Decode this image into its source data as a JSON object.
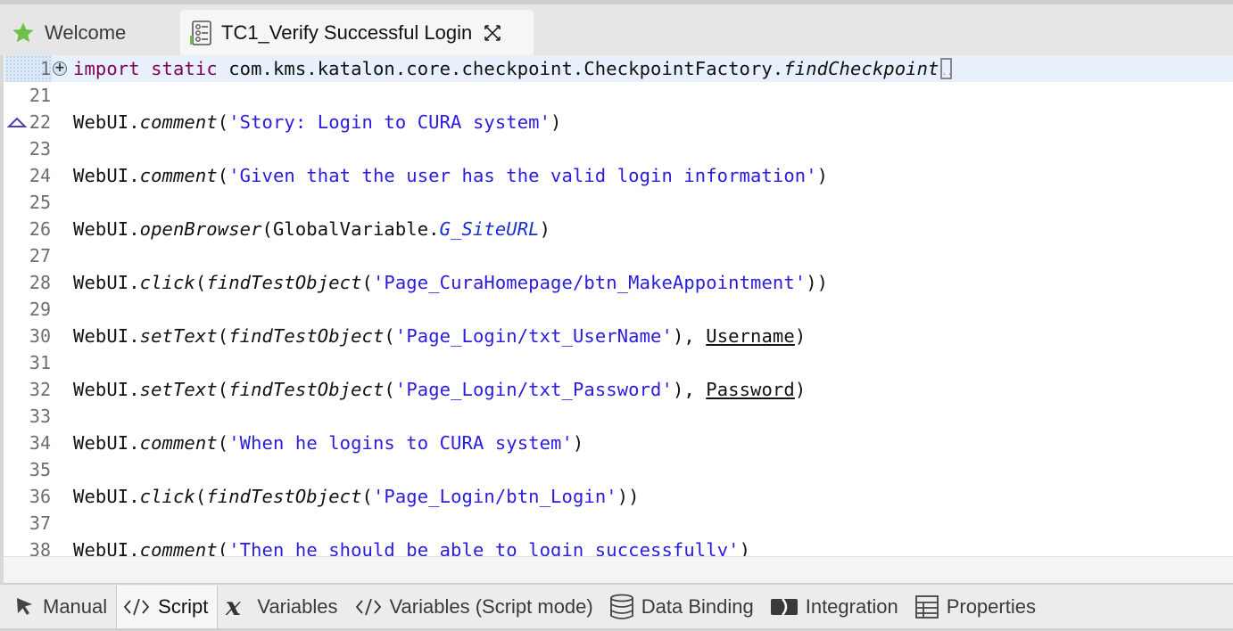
{
  "tabs": [
    {
      "label": "Welcome",
      "icon": "star-icon",
      "active": false
    },
    {
      "label": "TC1_Verify Successful Login",
      "icon": "test-case-icon",
      "active": true,
      "closable": true
    }
  ],
  "editor": {
    "lines": [
      {
        "num": "1",
        "folded": true,
        "tokens": [
          {
            "t": "import",
            "c": "kw"
          },
          {
            "t": " "
          },
          {
            "t": "static",
            "c": "kw"
          },
          {
            "t": " com.kms.katalon.core.checkpoint.CheckpointFactory."
          },
          {
            "t": "findCheckpoint",
            "c": "it"
          }
        ]
      },
      {
        "num": "21",
        "tokens": []
      },
      {
        "num": "22",
        "bookmark": true,
        "tokens": [
          {
            "t": "WebUI."
          },
          {
            "t": "comment",
            "c": "it"
          },
          {
            "t": "("
          },
          {
            "t": "'Story: Login to CURA system'",
            "c": "str"
          },
          {
            "t": ")"
          }
        ]
      },
      {
        "num": "23",
        "tokens": []
      },
      {
        "num": "24",
        "tokens": [
          {
            "t": "WebUI."
          },
          {
            "t": "comment",
            "c": "it"
          },
          {
            "t": "("
          },
          {
            "t": "'Given that the user has the valid login information'",
            "c": "str"
          },
          {
            "t": ")"
          }
        ]
      },
      {
        "num": "25",
        "tokens": []
      },
      {
        "num": "26",
        "tokens": [
          {
            "t": "WebUI."
          },
          {
            "t": "openBrowser",
            "c": "it"
          },
          {
            "t": "(GlobalVariable."
          },
          {
            "t": "G_SiteURL",
            "c": "sv"
          },
          {
            "t": ")"
          }
        ]
      },
      {
        "num": "27",
        "tokens": []
      },
      {
        "num": "28",
        "tokens": [
          {
            "t": "WebUI."
          },
          {
            "t": "click",
            "c": "it"
          },
          {
            "t": "("
          },
          {
            "t": "findTestObject",
            "c": "it"
          },
          {
            "t": "("
          },
          {
            "t": "'Page_CuraHomepage/btn_MakeAppointment'",
            "c": "str"
          },
          {
            "t": "))"
          }
        ]
      },
      {
        "num": "29",
        "tokens": []
      },
      {
        "num": "30",
        "tokens": [
          {
            "t": "WebUI."
          },
          {
            "t": "setText",
            "c": "it"
          },
          {
            "t": "("
          },
          {
            "t": "findTestObject",
            "c": "it"
          },
          {
            "t": "("
          },
          {
            "t": "'Page_Login/txt_UserName'",
            "c": "str"
          },
          {
            "t": "), "
          },
          {
            "t": "Username",
            "c": "ul"
          },
          {
            "t": ")"
          }
        ]
      },
      {
        "num": "31",
        "tokens": []
      },
      {
        "num": "32",
        "tokens": [
          {
            "t": "WebUI."
          },
          {
            "t": "setText",
            "c": "it"
          },
          {
            "t": "("
          },
          {
            "t": "findTestObject",
            "c": "it"
          },
          {
            "t": "("
          },
          {
            "t": "'Page_Login/txt_Password'",
            "c": "str"
          },
          {
            "t": "), "
          },
          {
            "t": "Password",
            "c": "ul"
          },
          {
            "t": ")"
          }
        ]
      },
      {
        "num": "33",
        "tokens": []
      },
      {
        "num": "34",
        "tokens": [
          {
            "t": "WebUI."
          },
          {
            "t": "comment",
            "c": "it"
          },
          {
            "t": "("
          },
          {
            "t": "'When he logins to CURA system'",
            "c": "str"
          },
          {
            "t": ")"
          }
        ]
      },
      {
        "num": "35",
        "tokens": []
      },
      {
        "num": "36",
        "tokens": [
          {
            "t": "WebUI."
          },
          {
            "t": "click",
            "c": "it"
          },
          {
            "t": "("
          },
          {
            "t": "findTestObject",
            "c": "it"
          },
          {
            "t": "("
          },
          {
            "t": "'Page_Login/btn_Login'",
            "c": "str"
          },
          {
            "t": "))"
          }
        ]
      },
      {
        "num": "37",
        "tokens": []
      },
      {
        "num": "38",
        "tokens": [
          {
            "t": "WebUI."
          },
          {
            "t": "comment",
            "c": "it"
          },
          {
            "t": "("
          },
          {
            "t": "'Then he should be able to login successfully'",
            "c": "str"
          },
          {
            "t": ")"
          }
        ]
      }
    ]
  },
  "bottom_tabs": [
    {
      "label": "Manual",
      "icon": "cursor-arrow-icon",
      "active": false
    },
    {
      "label": "Script",
      "icon": "code-icon",
      "active": true
    },
    {
      "label": "Variables",
      "icon": "variable-x-icon",
      "active": false
    },
    {
      "label": "Variables (Script mode)",
      "icon": "code-icon",
      "active": false
    },
    {
      "label": "Data Binding",
      "icon": "database-icon",
      "active": false
    },
    {
      "label": "Integration",
      "icon": "integration-icon",
      "active": false
    },
    {
      "label": "Properties",
      "icon": "table-icon",
      "active": false
    }
  ],
  "colors": {
    "keyword": "#7f0055",
    "string": "#2a1cde",
    "static_var": "#1a2fd1",
    "line_highlight": "#e8f0fb"
  }
}
